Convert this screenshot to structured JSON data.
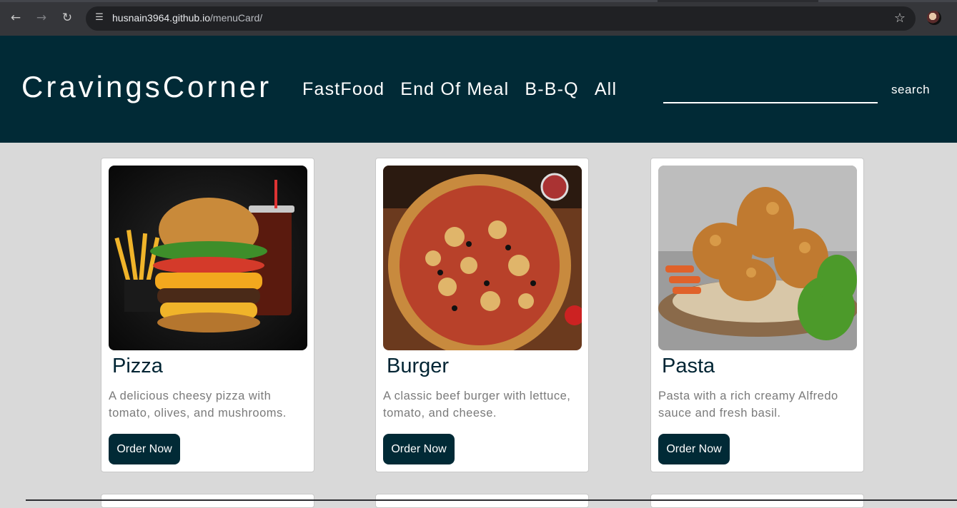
{
  "browser": {
    "url_host": "husnain3964.github.io",
    "url_path": "/menuCard/",
    "icons": {
      "back": "arrow-left-icon",
      "forward": "arrow-right-icon",
      "reload": "reload-icon",
      "site_info": "tune-icon",
      "bookmark": "star-icon"
    }
  },
  "header": {
    "brand": "CravingsCorner",
    "nav": [
      "FastFood",
      "End Of Meal",
      "B-B-Q",
      "All"
    ],
    "search_value": "",
    "search_label": "search"
  },
  "colors": {
    "header_bg": "#012a36",
    "page_bg": "#d9d9d9",
    "button_bg": "#012a36",
    "title": "#002433"
  },
  "cards": [
    {
      "title": "Pizza",
      "description": "A delicious cheesy pizza with tomato, olives, and mushrooms.",
      "button": "Order Now",
      "image": "burger-and-fries-photo"
    },
    {
      "title": "Burger",
      "description": "A classic beef burger with lettuce, tomato, and cheese.",
      "button": "Order Now",
      "image": "pizza-photo"
    },
    {
      "title": "Pasta",
      "description": "Pasta with a rich creamy Alfredo sauce and fresh basil.",
      "button": "Order Now",
      "image": "fried-chicken-photo"
    }
  ]
}
